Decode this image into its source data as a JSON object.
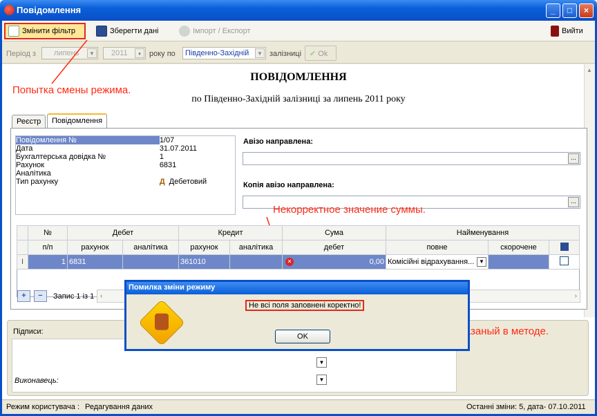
{
  "window": {
    "title": "Повідомлення",
    "min": "_",
    "max": "□",
    "close": "×"
  },
  "toolbar": {
    "change_filter": "Змінити фільтр",
    "save": "Зберегти дані",
    "import_export": "Імпорт / Експорт",
    "exit": "Вийти"
  },
  "filter": {
    "period_label": "Період з",
    "month": "липень",
    "year": "2011",
    "year_label": "року по",
    "railway": "Південно-Західній",
    "railway_label": "залізниці",
    "ok": "Ok"
  },
  "heading": {
    "title": "ПОВІДОМЛЕННЯ",
    "subtitle": "по Південно-Західній  залізниці за липень 2011 року"
  },
  "tabs": [
    {
      "label": "Реєстр"
    },
    {
      "label": "Повідомлення"
    }
  ],
  "info": [
    {
      "key": "Повідомлення №",
      "value": "1/07"
    },
    {
      "key": "Дата",
      "value": "31.07.2011"
    },
    {
      "key": "Бухгалтерська довідка №",
      "value": "1"
    },
    {
      "key": "Рахунок",
      "value": "6831"
    },
    {
      "key": "Аналітика",
      "value": ""
    },
    {
      "key": "Тип рахунку",
      "value": "Дебетовий",
      "icon_letter": "Д"
    }
  ],
  "avizo": {
    "sent_label": "Авізо направлена:",
    "copy_label": "Копія авізо направлена:",
    "dots": "..."
  },
  "grid": {
    "header1": {
      "num": "№",
      "debet": "Дебет",
      "kredit": "Кредит",
      "suma": "Сума",
      "name": "Найменування"
    },
    "header2": {
      "pp": "п/п",
      "rahunok": "рахунок",
      "analityka": "аналітика",
      "rahunok2": "рахунок",
      "analityka2": "аналітика",
      "debet": "дебет",
      "full": "повне",
      "short": "скорочене"
    },
    "row": {
      "marker": "I",
      "num": "1",
      "debet_account": "6831",
      "debet_analytics": "",
      "credit_account": "361010",
      "credit_analytics": "",
      "sum": "0,00",
      "full_name": "Комісійні відрахування...",
      "short_name": ""
    },
    "record": "Запис 1 із 1"
  },
  "bottom": {
    "signatures": "Підписи:",
    "executor": "Виконавець:"
  },
  "status": {
    "mode_label": "Режим користувача :",
    "mode_value": "Редагування даних",
    "last_changes": "Останні зміни: 5, дата- 07.10.2011"
  },
  "dialog": {
    "title": "Помилка зміни режиму",
    "message": "Не всі поля заповнені коректно!",
    "ok": "OK"
  },
  "annotations": {
    "a1": "Попытка смены режима.",
    "a2": "Некорректное значение суммы.",
    "a3": "Текст ошибки указаный в методе."
  },
  "colors": {
    "annotation": "#ff2a14",
    "selection": "#6e87c9",
    "titlebar": "#0a5fd8"
  }
}
